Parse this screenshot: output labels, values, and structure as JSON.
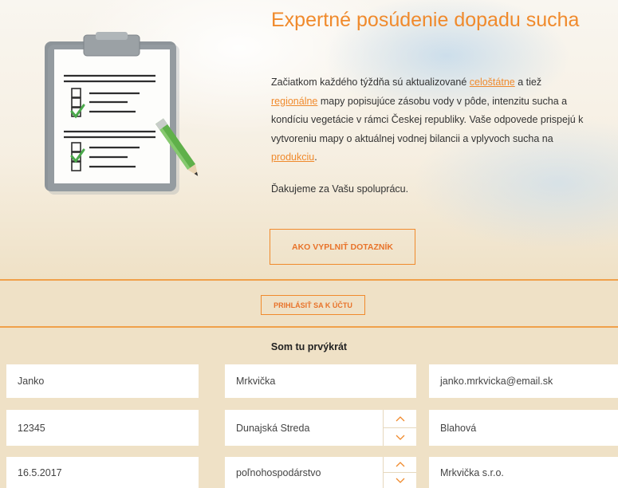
{
  "hero": {
    "title": "Expertné posúdenie dopadu sucha",
    "intro": {
      "p1": "Začiatkom každého týždňa sú aktualizované ",
      "link1": "celoštátne",
      "p2": " a tiež ",
      "link2": "regionálne",
      "p3": " mapy popisujúce zásobu vody v pôde, intenzitu sucha a kondíciu vegetácie v rámci Českej republiky. Vaše odpovede prispejú k vytvoreniu mapy o aktuálnej vodnej bilancii a vplyvoch sucha na ",
      "link3": "produkciu",
      "p4": "."
    },
    "thanks": "Ďakujeme za Vašu spoluprácu.",
    "howto_button": "AKO VYPLNIŤ DOTAZNÍK"
  },
  "login_button": "PRIHLÁSIŤ SA K ÚČTU",
  "form": {
    "section_title": "Som tu prvýkrát",
    "first_name": "Janko",
    "last_name": "Mrkvička",
    "email": "janko.mrkvicka@email.sk",
    "postal_code": "12345",
    "district": "Dunajská Streda",
    "municipality": "Blahová",
    "date": "16.5.2017",
    "sector": "poľnohospodárstvo",
    "company": "Mrkvička s.r.o."
  },
  "colors": {
    "accent": "#f08a2c",
    "form_background": "#efe1c6",
    "checkmark": "#4aa84a"
  },
  "icons": {
    "clipboard": "clipboard-checklist-icon",
    "chevron_up": "chevron-up-icon",
    "chevron_down": "chevron-down-icon"
  }
}
